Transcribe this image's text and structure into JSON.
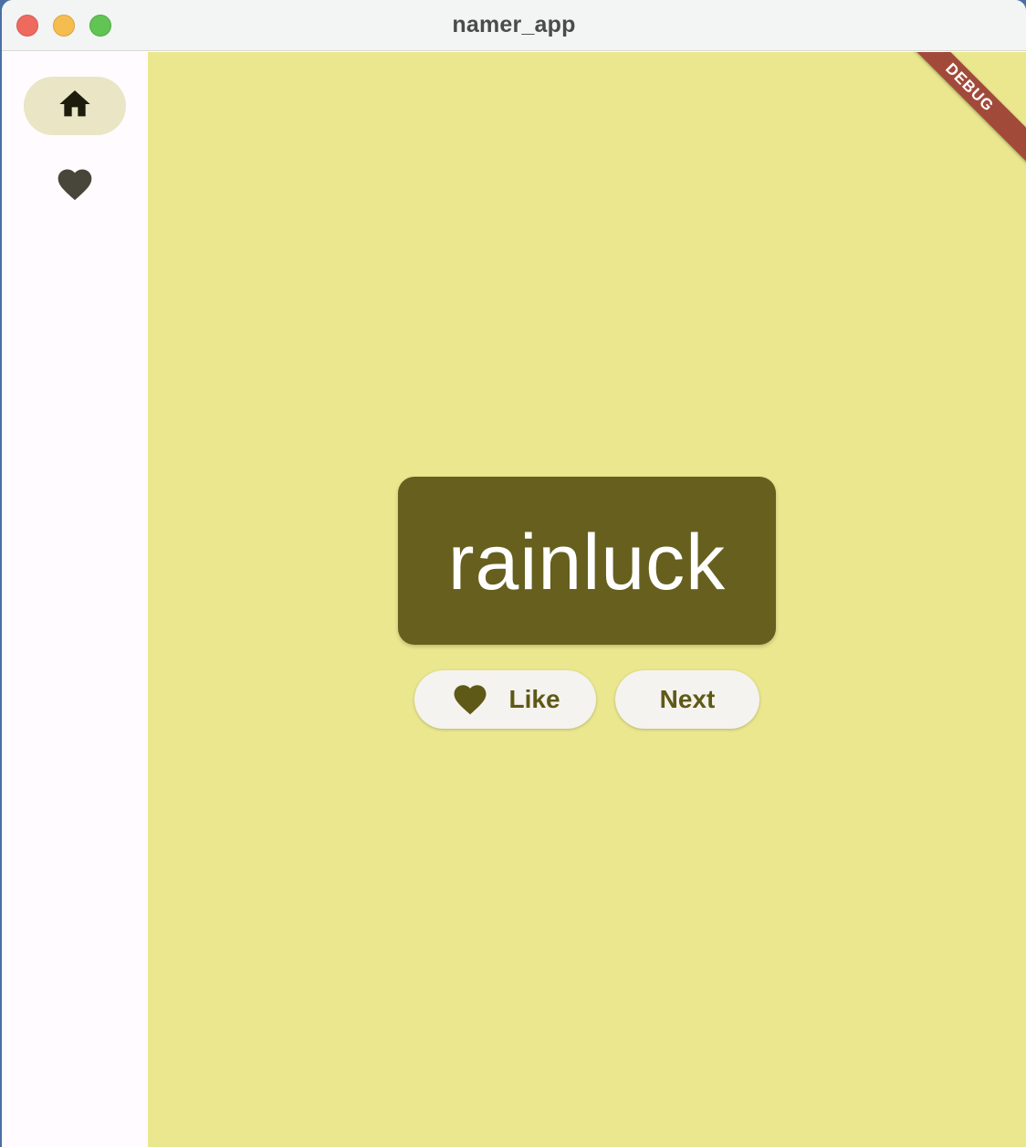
{
  "window": {
    "title": "namer_app"
  },
  "nav_rail": {
    "items": [
      {
        "icon": "home-icon",
        "selected": true
      },
      {
        "icon": "heart-icon",
        "selected": false
      }
    ]
  },
  "content": {
    "debug_banner": "DEBUG",
    "word_pair": "rainluck",
    "like_label": "Like",
    "next_label": "Next"
  },
  "colors": {
    "background": "#eae78f",
    "card": "#675f1e",
    "rail": "#fffbfe",
    "rail_selected": "#e9e5c5",
    "button_text": "#5f5917",
    "debug": "#a24a3a"
  }
}
